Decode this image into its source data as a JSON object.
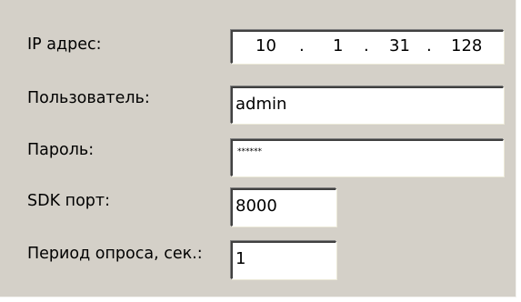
{
  "form": {
    "ip_label": "IP адрес:",
    "ip_octets": [
      "10",
      "1",
      "31",
      "128"
    ],
    "ip_dot": ".",
    "user_label": "Пользователь:",
    "user_value": "admin",
    "password_label": "Пароль:",
    "password_value": "******",
    "sdk_port_label": "SDK порт:",
    "sdk_port_value": "8000",
    "poll_label": "Период опроса, сек.:",
    "poll_value": "1"
  },
  "colors": {
    "panel_background": "#d4d0c8",
    "field_background": "#ffffff",
    "field_border_dark": "#404040"
  }
}
